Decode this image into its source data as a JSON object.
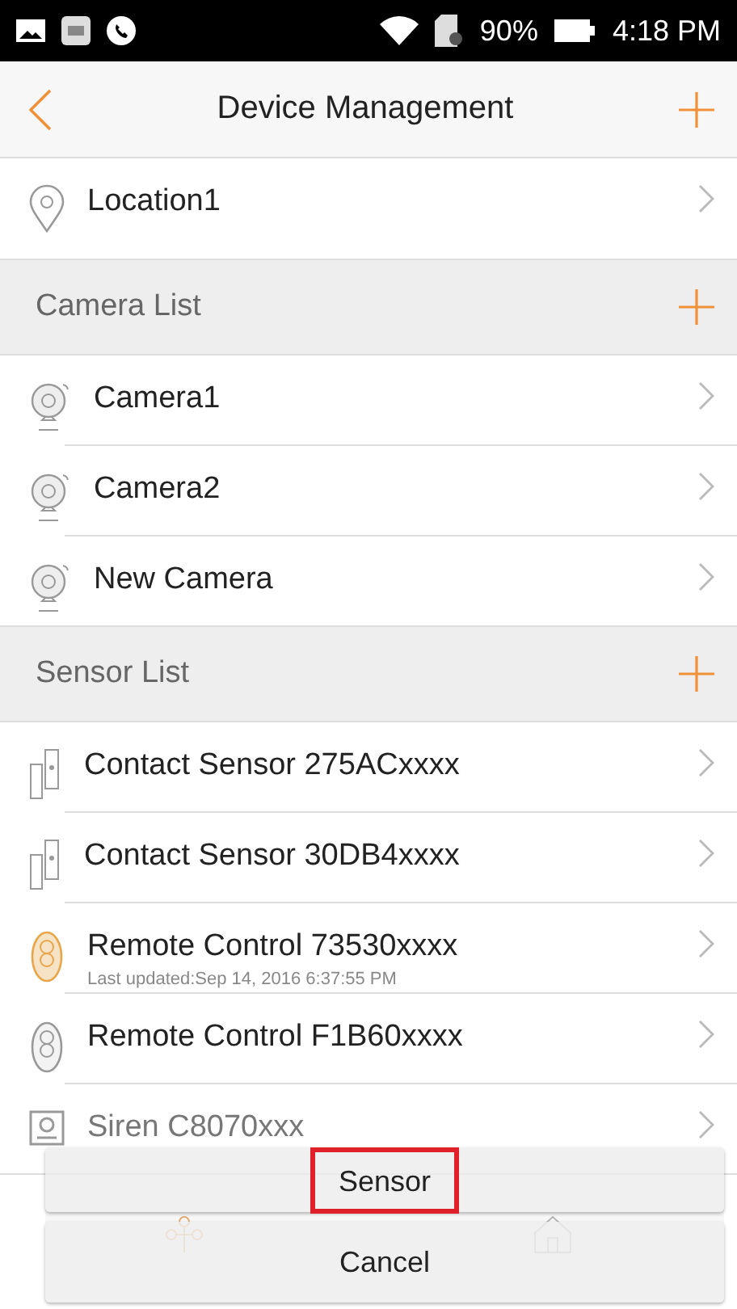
{
  "status_bar": {
    "battery": "90%",
    "time": "4:18 PM"
  },
  "header": {
    "title": "Device Management"
  },
  "location": {
    "name": "Location1"
  },
  "sections": [
    {
      "title": "Camera List",
      "items": [
        {
          "name": "Camera1",
          "kind": "camera"
        },
        {
          "name": "Camera2",
          "kind": "camera"
        },
        {
          "name": "New Camera",
          "kind": "camera"
        }
      ]
    },
    {
      "title": "Sensor List",
      "items": [
        {
          "name": "Contact Sensor 275ACxxxx",
          "kind": "contact"
        },
        {
          "name": "Contact Sensor 30DB4xxxx",
          "kind": "contact"
        },
        {
          "name": "Remote Control 73530xxxx",
          "kind": "remote",
          "active": true,
          "subtitle": "Last updated:Sep 14, 2016 6:37:55 PM"
        },
        {
          "name": "Remote Control F1B60xxxx",
          "kind": "remote",
          "active": false
        },
        {
          "name": "Siren C8070xxx",
          "kind": "siren"
        }
      ]
    }
  ],
  "action_sheet": {
    "options": [
      {
        "label": "Sensor",
        "highlighted": true
      }
    ],
    "cancel": "Cancel"
  }
}
